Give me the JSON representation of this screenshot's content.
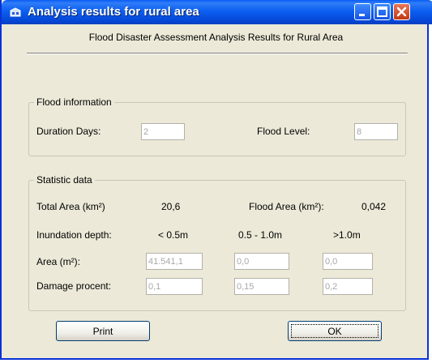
{
  "window": {
    "title": "Analysis results for rural area",
    "icon": "app-icon",
    "controls": [
      "minimize-icon",
      "maximize-icon",
      "close-icon"
    ],
    "colors": {
      "titlebar": "#0a5bf4",
      "face": "#ece9d8",
      "close": "#c2370f"
    }
  },
  "heading": "Flood Disaster Assessment Analysis Results for Rural Area",
  "flood_info": {
    "legend": "Flood information",
    "duration_label": "Duration Days:",
    "duration_value": "2",
    "level_label": "Flood Level:",
    "level_value": "8"
  },
  "stats": {
    "legend": "Statistic data",
    "total_area_label": "Total Area (km²)",
    "total_area_value": "20,6",
    "flood_area_label": "Flood Area (km²):",
    "flood_area_value": "0,042",
    "depth_label": "Inundation depth:",
    "depth_cols": [
      "< 0.5m",
      "0.5 - 1.0m",
      ">1.0m"
    ],
    "area_label": "Area (m²):",
    "area_values": [
      "41.541,1",
      "0,0",
      "0,0"
    ],
    "damage_label": "Damage procent:",
    "damage_values": [
      "0,1",
      "0,15",
      "0,2"
    ]
  },
  "buttons": {
    "print": "Print",
    "ok": "OK"
  }
}
